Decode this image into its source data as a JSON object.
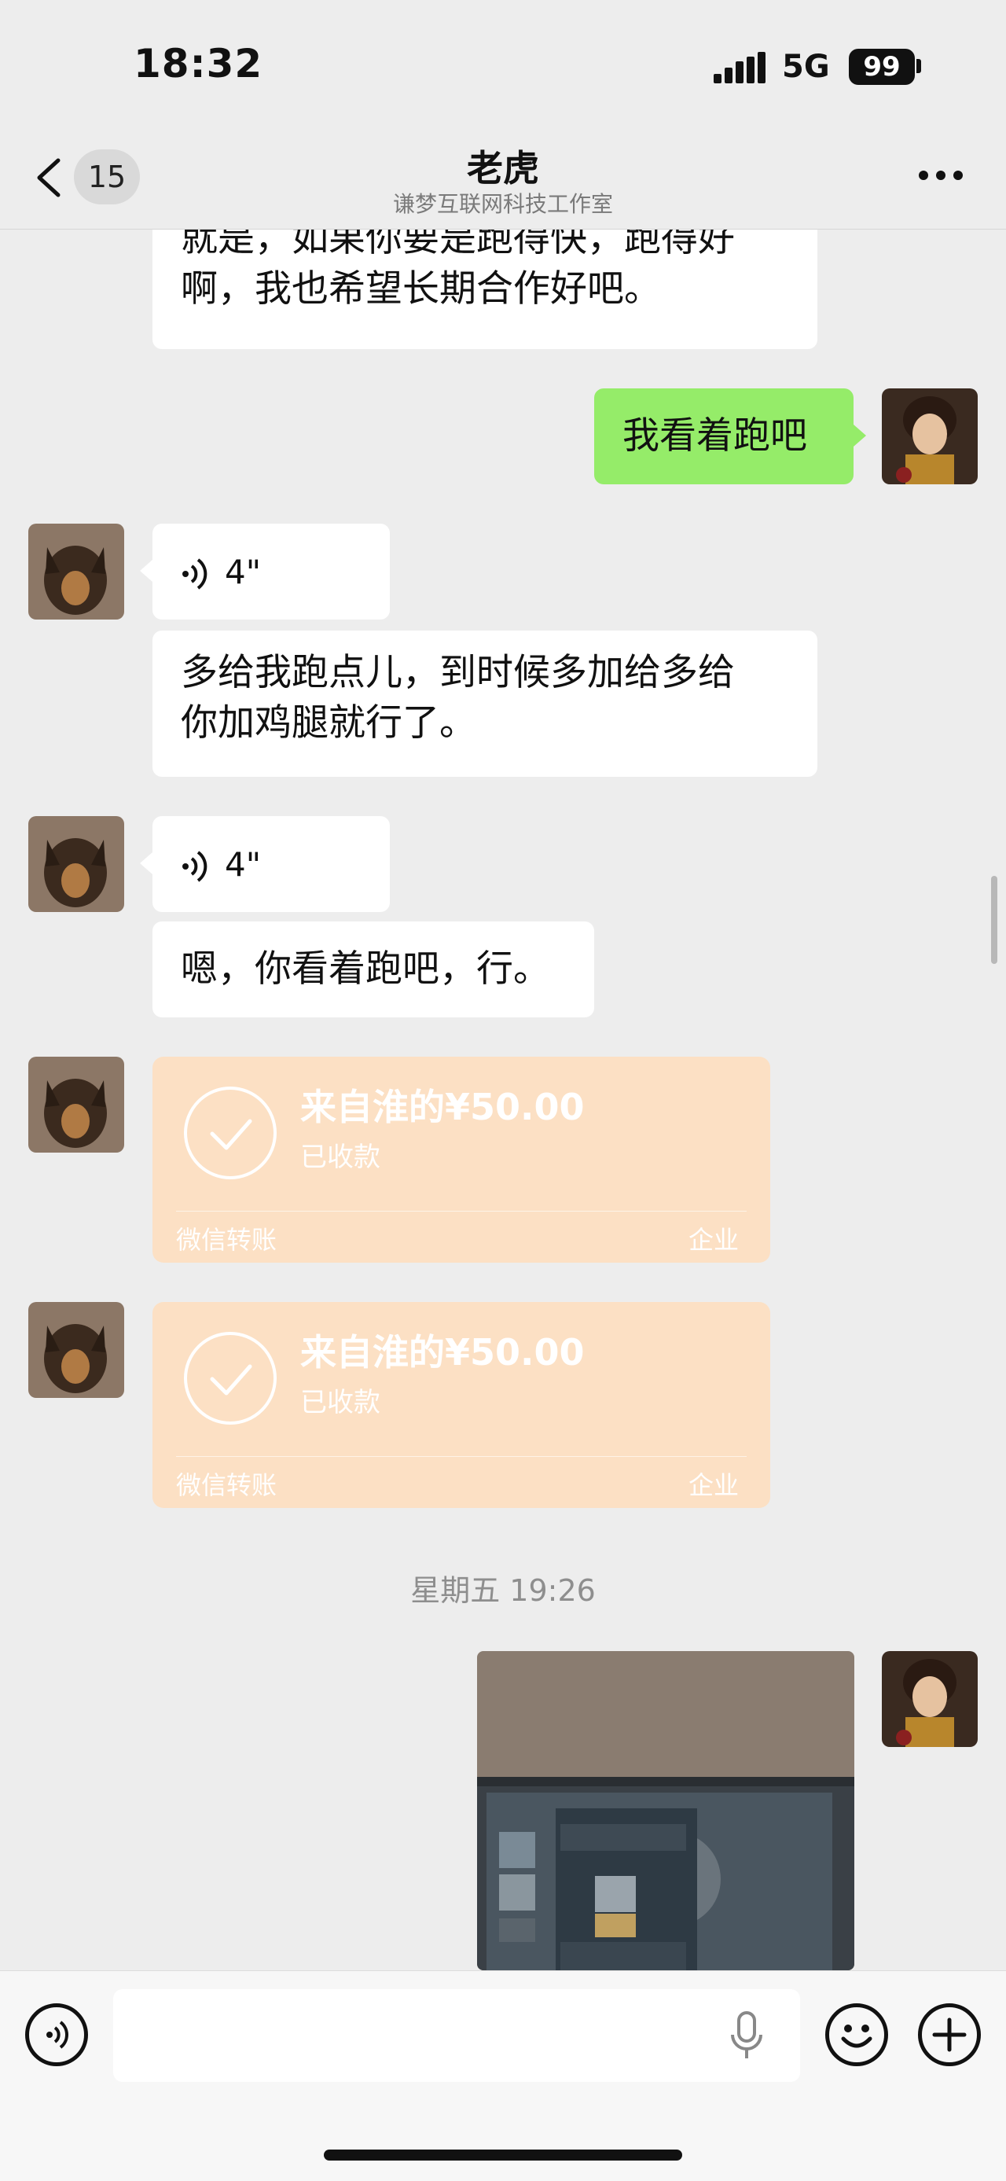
{
  "status_bar": {
    "time": "18:32",
    "network": "5G",
    "battery": "99"
  },
  "nav": {
    "unread_count": "15",
    "title": "老虎",
    "subtitle": "谦梦互联网科技工作室",
    "back_icon": "chevron-left-icon",
    "more_icon": "more-dots-icon"
  },
  "messages": [
    {
      "type": "text",
      "side": "left",
      "lines": [
        "就是，如果你要是跑得快，跑得好",
        "啊，我也希望长期合作好吧。"
      ]
    },
    {
      "type": "text",
      "side": "right",
      "text": "我看着跑吧"
    },
    {
      "type": "voice",
      "side": "left",
      "duration": "4\""
    },
    {
      "type": "text",
      "side": "left",
      "lines": [
        "多给我跑点儿，到时候多加给多给",
        "你加鸡腿就行了。"
      ]
    },
    {
      "type": "voice",
      "side": "left",
      "duration": "4\""
    },
    {
      "type": "text",
      "side": "left",
      "text": "嗯，你看着跑吧，行。"
    },
    {
      "type": "transfer",
      "side": "left",
      "amount": "来自淮的¥50.00",
      "status": "已收款",
      "footer_left": "微信转账",
      "footer_right": "企业"
    },
    {
      "type": "transfer",
      "side": "left",
      "amount": "来自淮的¥50.00",
      "status": "已收款",
      "footer_left": "微信转账",
      "footer_right": "企业"
    },
    {
      "type": "image",
      "side": "right",
      "description_icon": "photo-icon"
    }
  ],
  "timestamp": "星期五 19:26",
  "input_bar": {
    "voice_icon": "voice-mode-icon",
    "mic_icon": "microphone-icon",
    "emoji_icon": "emoji-icon",
    "plus_icon": "plus-icon"
  },
  "colors": {
    "background": "#ededed",
    "self_bubble": "#95ec69",
    "other_bubble": "#ffffff",
    "transfer_card": "#fce0c4"
  }
}
